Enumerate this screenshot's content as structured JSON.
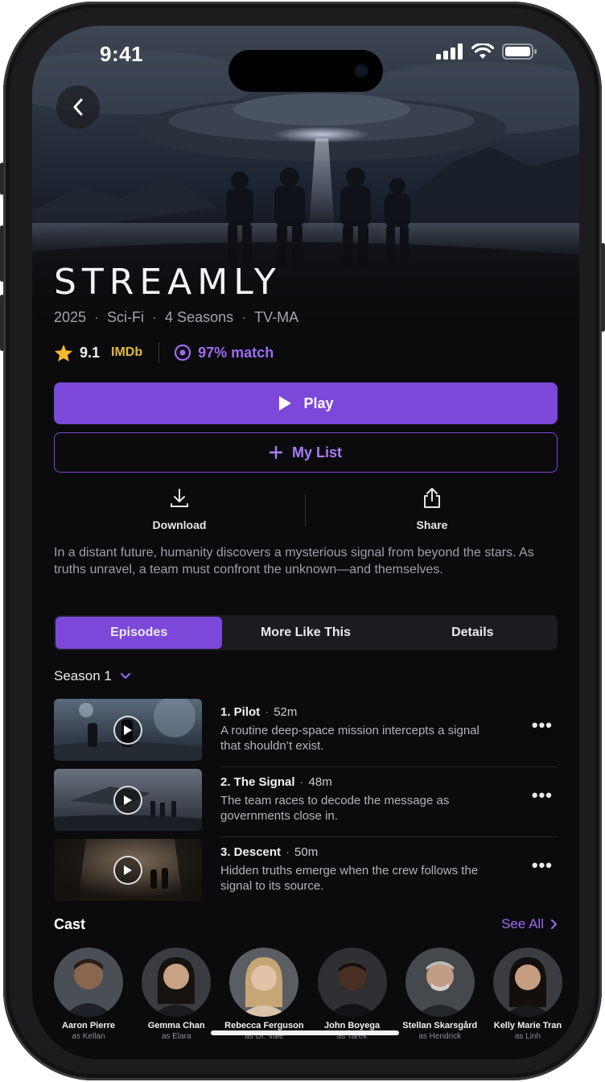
{
  "status_bar": {
    "time": "9:41"
  },
  "show": {
    "title": "STREAMLY",
    "meta": [
      "2025",
      "Sci-Fi",
      "4 Seasons",
      "TV-MA"
    ],
    "rating": "9.1",
    "rating_source": "IMDb",
    "match": "97% match",
    "synopsis": "In a distant future, humanity discovers a mysterious signal from beyond the stars. As truths unravel, a team must confront the unknown—and themselves."
  },
  "buttons": {
    "play": "Play",
    "my_list": "My List",
    "download": "Download",
    "share": "Share"
  },
  "tabs": [
    {
      "label": "Episodes",
      "active": true
    },
    {
      "label": "More Like This",
      "active": false
    },
    {
      "label": "Details",
      "active": false
    }
  ],
  "season_selector": "Season 1",
  "episodes": [
    {
      "title": "1. Pilot",
      "duration": "52m",
      "description": "A routine deep-space mission intercepts a signal that shouldn’t exist."
    },
    {
      "title": "2. The Signal",
      "duration": "48m",
      "description": "The team races to decode the message as governments close in."
    },
    {
      "title": "3. Descent",
      "duration": "50m",
      "description": "Hidden truths emerge when the crew follows the signal to its source."
    }
  ],
  "cast_section": {
    "label": "Cast",
    "see_all": "See All"
  },
  "cast": [
    {
      "name": "Aaron Pierre",
      "role": "as Kellan"
    },
    {
      "name": "Gemma Chan",
      "role": "as Elara"
    },
    {
      "name": "Rebecca Ferguson",
      "role": "as Dr. Vale"
    },
    {
      "name": "John Boyega",
      "role": "as Tarek"
    },
    {
      "name": "Stellan Skarsgård",
      "role": "as Hendrick"
    },
    {
      "name": "Kelly Marie Tran",
      "role": "as Linh"
    }
  ],
  "colors": {
    "accent": "#7b48d9",
    "accent_text": "#9d6cf0",
    "star": "#f5b82e",
    "imdb": "#e6b93b",
    "background": "#0b0b0d"
  },
  "icons": [
    "back-chevron-icon",
    "signal-icon",
    "wifi-icon",
    "battery-icon",
    "star-icon",
    "eye-icon",
    "play-icon",
    "plus-icon",
    "download-icon",
    "share-icon",
    "chevron-down-icon",
    "more-icon",
    "chevron-right-icon"
  ]
}
